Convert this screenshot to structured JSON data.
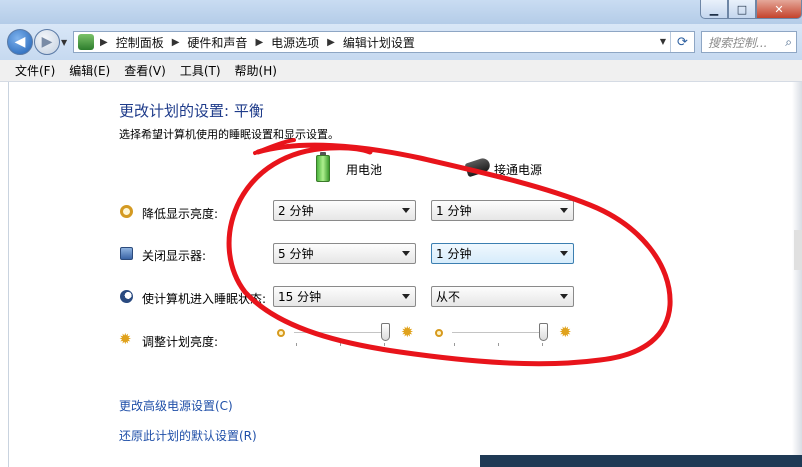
{
  "window": {
    "caption": {
      "minimize": "▁",
      "maximize": "□",
      "close": "✕"
    }
  },
  "address": {
    "crumbs": [
      "控制面板",
      "硬件和声音",
      "电源选项",
      "编辑计划设置"
    ],
    "search_placeholder": "搜索控制..."
  },
  "menu": [
    "文件(F)",
    "编辑(E)",
    "查看(V)",
    "工具(T)",
    "帮助(H)"
  ],
  "page": {
    "title": "更改计划的设置: 平衡",
    "subtitle": "选择希望计算机使用的睡眠设置和显示设置。"
  },
  "columns": {
    "battery": "用电池",
    "plugged": "接通电源"
  },
  "rows": [
    {
      "label": "降低显示亮度:",
      "icon": "dim-display-icon",
      "battery": "2 分钟",
      "plugged": "1 分钟"
    },
    {
      "label": "关闭显示器:",
      "icon": "monitor-off-icon",
      "battery": "5 分钟",
      "plugged": "1 分钟"
    },
    {
      "label": "使计算机进入睡眠状态:",
      "icon": "sleep-moon-icon",
      "battery": "15 分钟",
      "plugged": "从不"
    }
  ],
  "brightness": {
    "label": "调整计划亮度:",
    "battery_level": 0.99,
    "plugged_level": 0.99
  },
  "links": {
    "advanced": "更改高级电源设置(C)",
    "restore": "还原此计划的默认设置(R)"
  },
  "colors": {
    "title_blue": "#1e3b8a",
    "link_blue": "#1f4fa8",
    "annotation_red": "#e8141b"
  }
}
